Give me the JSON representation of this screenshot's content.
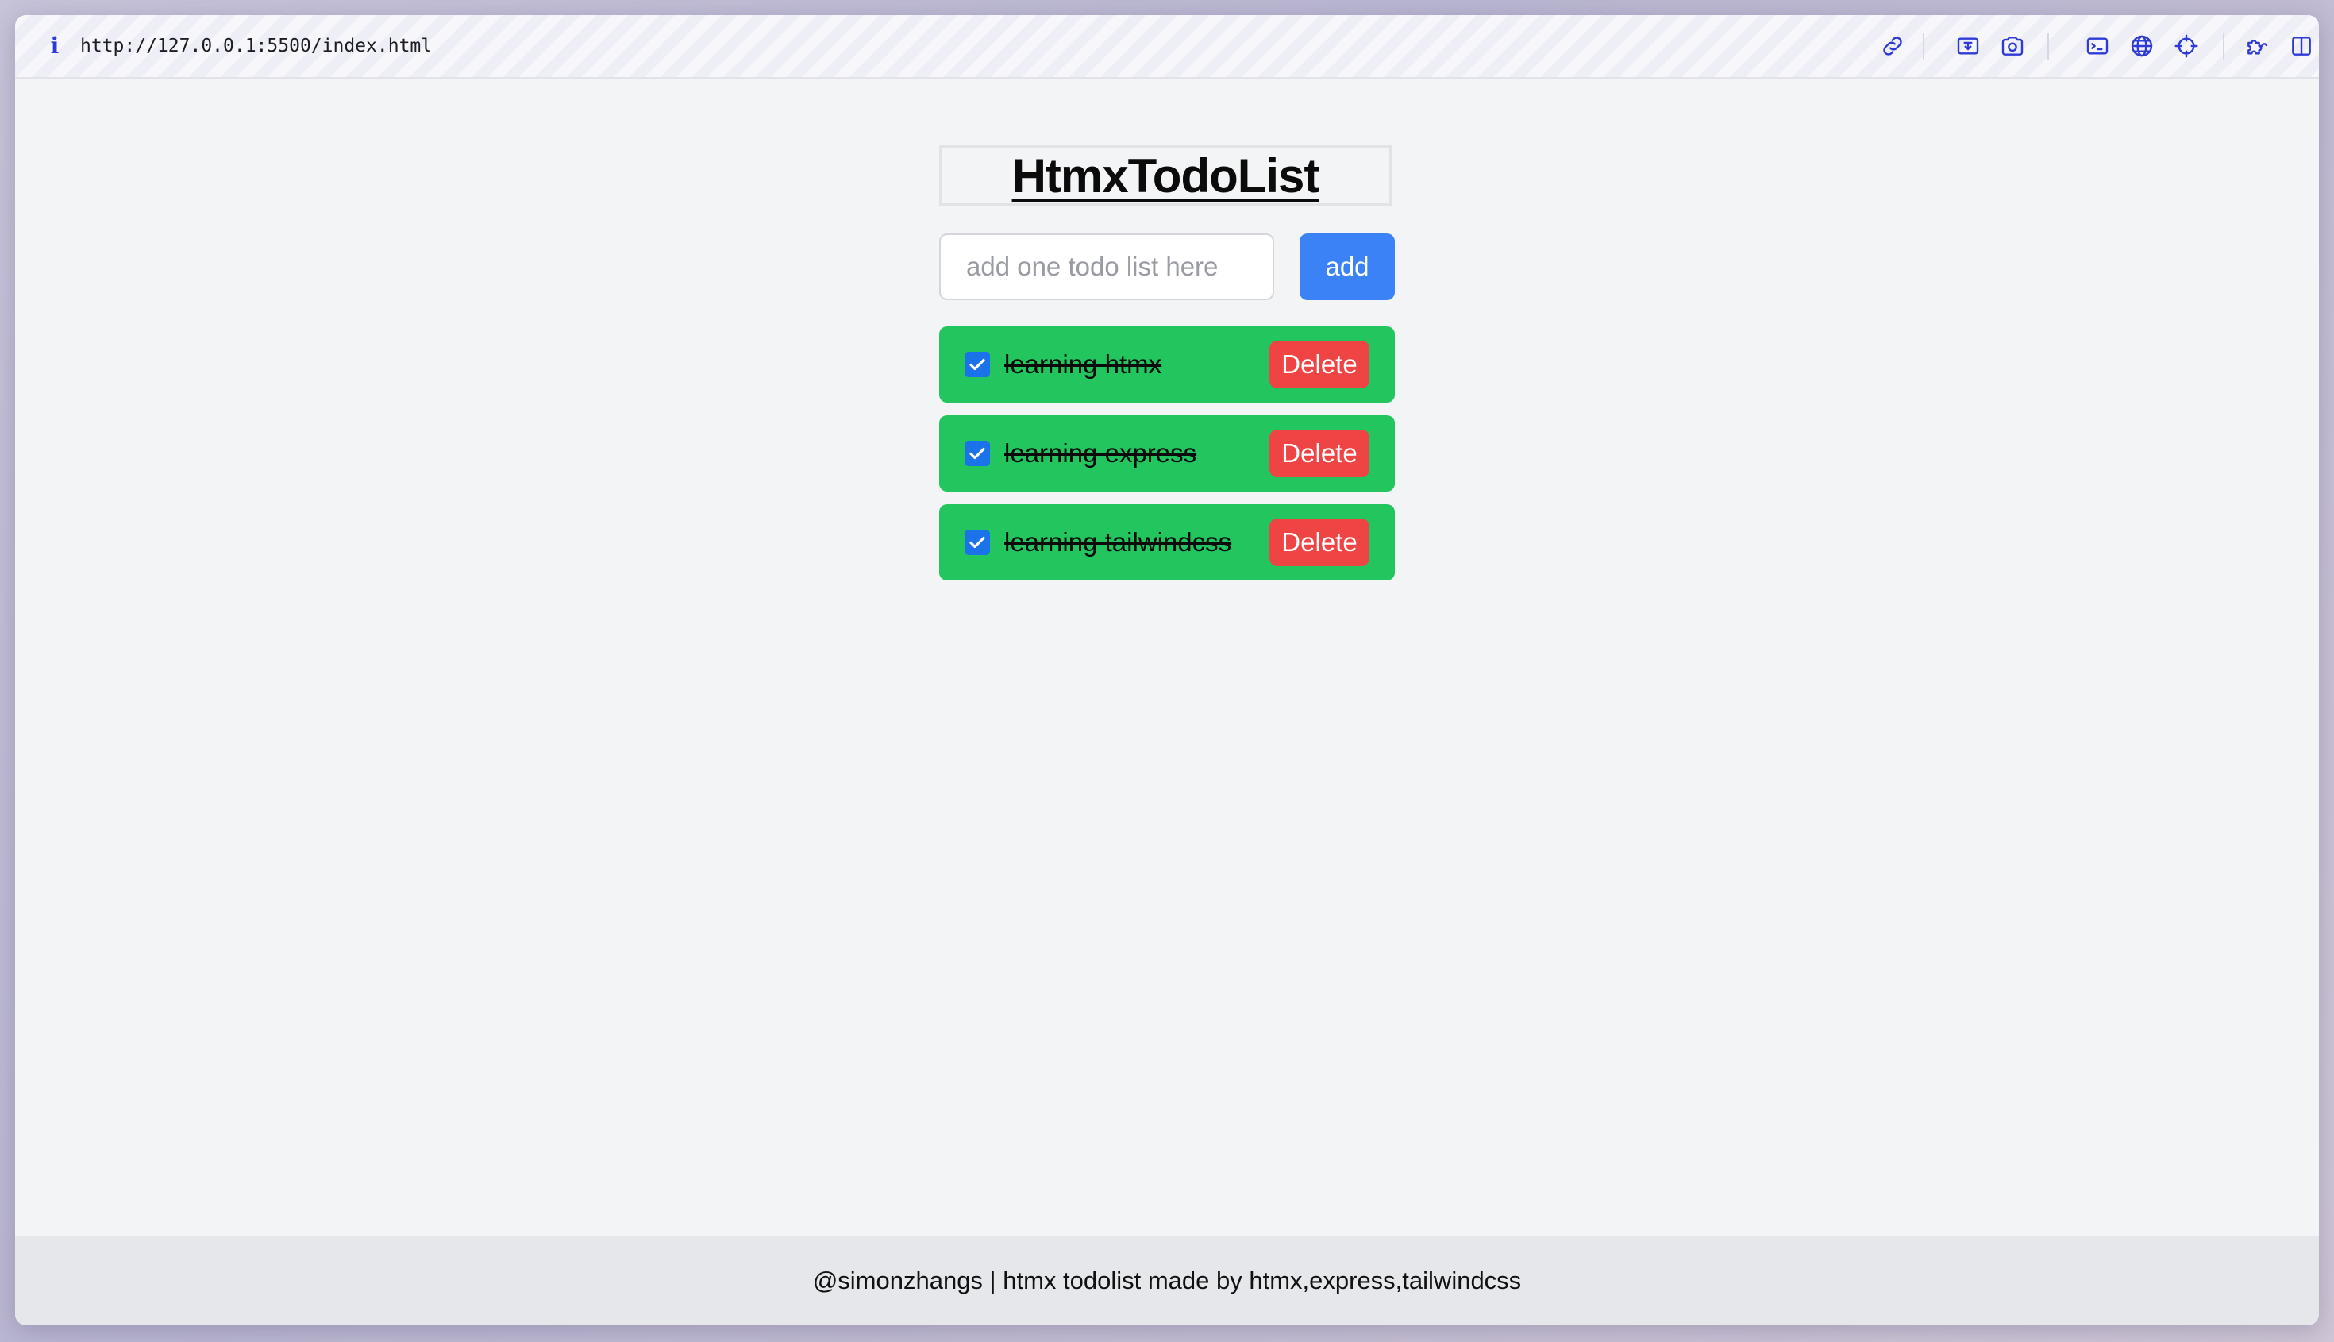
{
  "browser": {
    "url": "http://127.0.0.1:5500/index.html",
    "toolbar_icons": [
      "link-icon",
      "screenshot-region-icon",
      "camera-icon",
      "terminal-icon",
      "globe-icon",
      "crosshair-icon",
      "puzzle-icon",
      "split-view-icon"
    ]
  },
  "app": {
    "title": "HtmxTodoList",
    "input": {
      "value": "",
      "placeholder": "add one todo list here"
    },
    "add_label": "add",
    "todos": [
      {
        "text": "learning htmx",
        "checked": true,
        "delete_label": "Delete"
      },
      {
        "text": "learning express",
        "checked": true,
        "delete_label": "Delete"
      },
      {
        "text": "learning tailwindcss",
        "checked": true,
        "delete_label": "Delete"
      }
    ]
  },
  "footer": {
    "text": "@simonzhangs | htmx todolist made by htmx,express,tailwindcss"
  },
  "colors": {
    "todo_bg": "#22c55e",
    "add_button": "#3b82f6",
    "delete_button": "#ef4444",
    "checkbox": "#1a73e8",
    "toolbar_icon": "#2f3bd6"
  }
}
